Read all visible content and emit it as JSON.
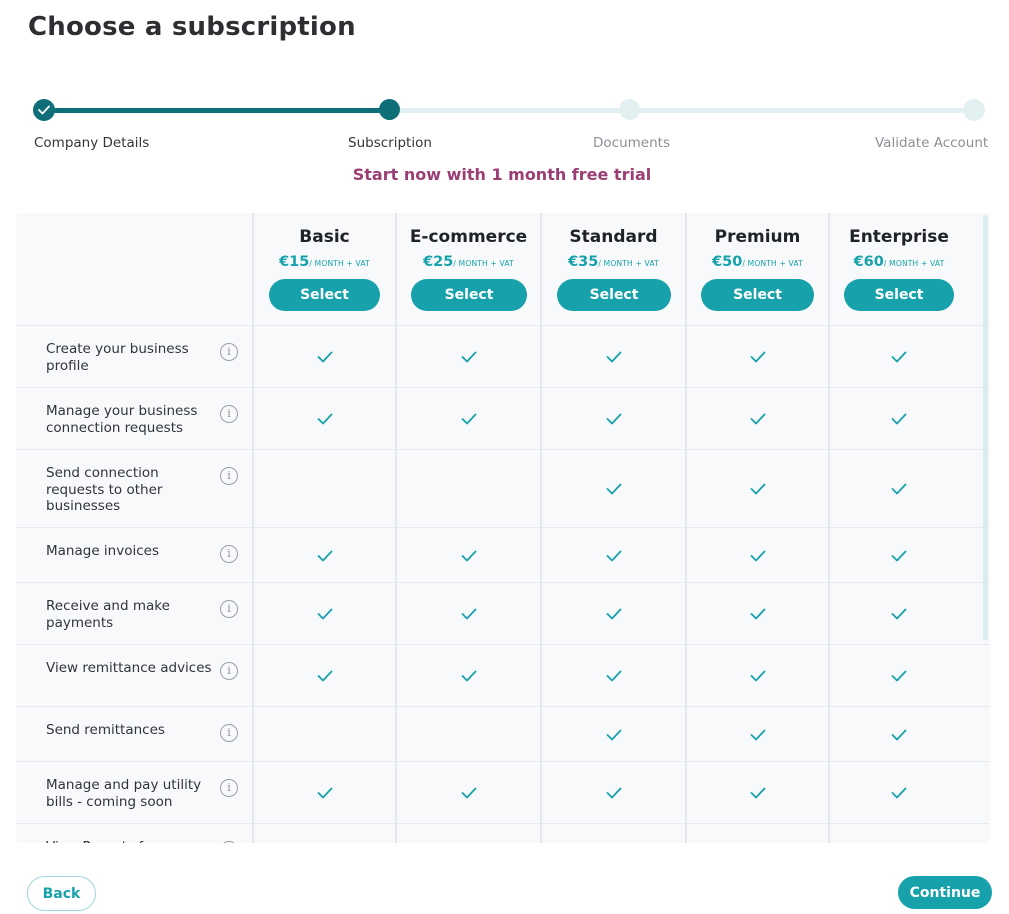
{
  "page": {
    "title": "Choose a subscription"
  },
  "stepper": {
    "steps": [
      {
        "label": "Company Details",
        "state": "completed"
      },
      {
        "label": "Subscription",
        "state": "current"
      },
      {
        "label": "Documents",
        "state": "upcoming"
      },
      {
        "label": "Validate Account",
        "state": "upcoming"
      }
    ]
  },
  "trial_banner": "Start now with 1 month free trial",
  "plans": [
    {
      "name": "Basic",
      "price": "€15",
      "period": "/ MONTH + VAT",
      "select_label": "Select"
    },
    {
      "name": "E-commerce",
      "price": "€25",
      "period": "/ MONTH + VAT",
      "select_label": "Select"
    },
    {
      "name": "Standard",
      "price": "€35",
      "period": "/ MONTH + VAT",
      "select_label": "Select"
    },
    {
      "name": "Premium",
      "price": "€50",
      "period": "/ MONTH + VAT",
      "select_label": "Select"
    },
    {
      "name": "Enterprise",
      "price": "€60",
      "period": "/ MONTH + VAT",
      "select_label": "Select"
    }
  ],
  "features": [
    {
      "label": "Create your business profile",
      "included": [
        true,
        true,
        true,
        true,
        true
      ]
    },
    {
      "label": "Manage your business connection requests",
      "included": [
        true,
        true,
        true,
        true,
        true
      ]
    },
    {
      "label": "Send connection requests to other businesses",
      "included": [
        false,
        false,
        true,
        true,
        true
      ]
    },
    {
      "label": "Manage invoices",
      "included": [
        true,
        true,
        true,
        true,
        true
      ]
    },
    {
      "label": "Receive and make payments",
      "included": [
        true,
        true,
        true,
        true,
        true
      ]
    },
    {
      "label": "View remittance advices",
      "included": [
        true,
        true,
        true,
        true,
        true
      ]
    },
    {
      "label": "Send remittances",
      "included": [
        false,
        false,
        true,
        true,
        true
      ]
    },
    {
      "label": "Manage and pay utility bills - coming soon",
      "included": [
        true,
        true,
        true,
        true,
        true
      ]
    },
    {
      "label": "View Reports for",
      "included": [
        false,
        false,
        false,
        false,
        false
      ]
    }
  ],
  "footer": {
    "back_label": "Back",
    "continue_label": "Continue"
  },
  "colors": {
    "accent": "#17a2ab",
    "stepper": "#0e6f78",
    "trial": "#9a3e74"
  },
  "icons": {
    "info": "info-icon",
    "check": "check-icon",
    "step_done": "checkmark-icon"
  }
}
